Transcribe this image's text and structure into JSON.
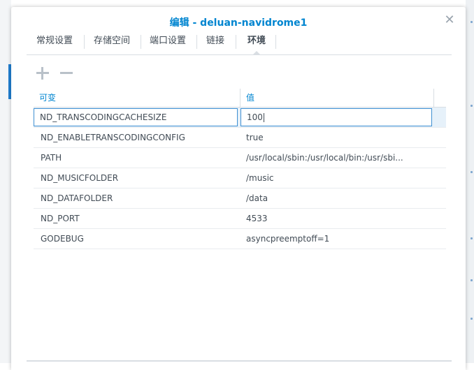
{
  "dialog": {
    "title": "编辑 - deluan-navidrome1",
    "close_icon": "close-icon"
  },
  "tabs": [
    {
      "label": "常规设置",
      "active": false
    },
    {
      "label": "存储空间",
      "active": false
    },
    {
      "label": "端口设置",
      "active": false
    },
    {
      "label": "链接",
      "active": false
    },
    {
      "label": "环境",
      "active": true
    }
  ],
  "toolbar": {
    "add_icon": "plus-icon",
    "remove_icon": "minus-icon"
  },
  "grid": {
    "columns": [
      "可变",
      "值"
    ],
    "rows": [
      {
        "variable": "ND_TRANSCODINGCACHESIZE",
        "value": "100",
        "editing": true
      },
      {
        "variable": "ND_ENABLETRANSCODINGCONFIG",
        "value": "true"
      },
      {
        "variable": "PATH",
        "value": "/usr/local/sbin:/usr/local/bin:/usr/sbi..."
      },
      {
        "variable": "ND_MUSICFOLDER",
        "value": "/music"
      },
      {
        "variable": "ND_DATAFOLDER",
        "value": "/data"
      },
      {
        "variable": "ND_PORT",
        "value": "4533"
      },
      {
        "variable": "GODEBUG",
        "value": "asyncpreemptoff=1"
      }
    ]
  },
  "colors": {
    "accent": "#0085d0",
    "selected_row": "#e6f1fa",
    "edit_border": "#3f8fd2"
  }
}
